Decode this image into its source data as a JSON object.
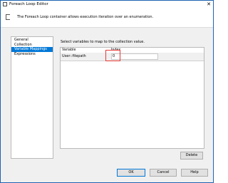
{
  "window": {
    "title": "Foreach Loop Editor",
    "close_glyph": "✕"
  },
  "header": {
    "description": "The Foreach Loop container allows execution iteration over an enumeration."
  },
  "nav": {
    "items": [
      "General",
      "Collection",
      "Variable Mappings",
      "Expressions"
    ],
    "selected": "Variable Mappings"
  },
  "main": {
    "instruction": "Select variables to map to the collection value.",
    "columns": [
      "Variable",
      "Index"
    ],
    "rows": [
      {
        "variable": "User::filepath",
        "index": "0"
      }
    ]
  },
  "buttons": {
    "delete": "Delete",
    "ok": "OK",
    "cancel": "Cancel",
    "help": "Help"
  },
  "colors": {
    "accent": "#0078d7",
    "highlight": "#e53935"
  }
}
